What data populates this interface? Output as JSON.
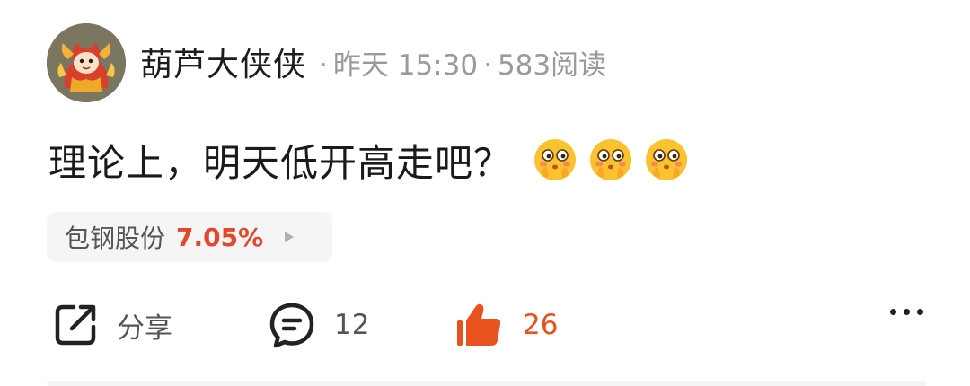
{
  "author": {
    "name": "葫芦大侠侠",
    "avatar_icon": "cartoon-character-avatar"
  },
  "meta": {
    "separator": "·",
    "time": "昨天 15:30",
    "views": "583阅读"
  },
  "post": {
    "text": "理论上，明天低开高走吧？",
    "emojis": [
      "blushing-face-emoji",
      "blushing-face-emoji",
      "blushing-face-emoji"
    ]
  },
  "stock": {
    "name": "包钢股份",
    "change": "7.05%",
    "change_color": "#e2492c"
  },
  "actions": {
    "share_label": "分享",
    "comment_count": "12",
    "like_count": "26",
    "like_color": "#e8521f"
  }
}
